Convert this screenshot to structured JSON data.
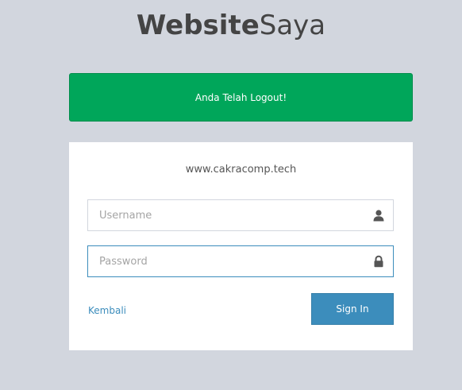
{
  "brand": {
    "bold": "Website",
    "light": "Saya"
  },
  "alert": {
    "message": "Anda Telah Logout!",
    "color": "#00a65a"
  },
  "login": {
    "site": "www.cakracomp.tech",
    "username": {
      "placeholder": "Username",
      "value": "",
      "icon": "user-icon"
    },
    "password": {
      "placeholder": "Password",
      "value": "",
      "icon": "lock-icon"
    },
    "back_label": "Kembali",
    "signin_label": "Sign In",
    "accent": "#3c8dbc"
  }
}
